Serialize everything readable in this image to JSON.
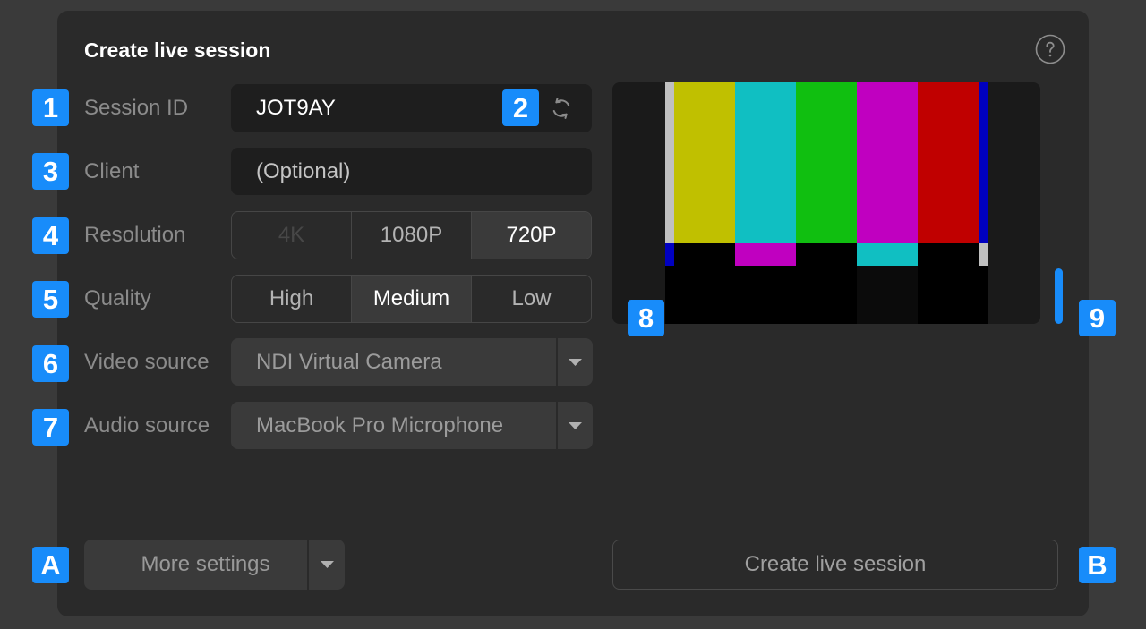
{
  "colors": {
    "page_background": "#3a3a3a",
    "panel_background": "#2a2a2a",
    "field_background": "#1e1e1e",
    "control_background": "#3a3a3a",
    "accent": "#188cfa",
    "label_text": "#8b8b8b",
    "title_text": "#ffffff"
  },
  "dialog": {
    "title": "Create live session",
    "help_icon": "question-circle-icon"
  },
  "form": {
    "session_id": {
      "badge": "1",
      "label": "Session ID",
      "value": "JOT9AY",
      "regenerate_badge": "2",
      "regenerate_icon": "refresh-icon"
    },
    "client": {
      "badge": "3",
      "label": "Client",
      "value": "",
      "placeholder": "(Optional)"
    },
    "resolution": {
      "badge": "4",
      "label": "Resolution",
      "options": [
        {
          "label": "4K",
          "selected": false,
          "disabled": true
        },
        {
          "label": "1080P",
          "selected": false,
          "disabled": false
        },
        {
          "label": "720P",
          "selected": true,
          "disabled": false
        }
      ]
    },
    "quality": {
      "badge": "5",
      "label": "Quality",
      "options": [
        {
          "label": "High",
          "selected": false,
          "disabled": false
        },
        {
          "label": "Medium",
          "selected": true,
          "disabled": false
        },
        {
          "label": "Low",
          "selected": false,
          "disabled": false
        }
      ]
    },
    "video_source": {
      "badge": "6",
      "label": "Video source",
      "value": "NDI Virtual Camera",
      "dropdown_icon": "caret-down-icon"
    },
    "audio_source": {
      "badge": "7",
      "label": "Audio source",
      "value": "MacBook Pro Microphone",
      "dropdown_icon": "caret-down-icon"
    }
  },
  "preview": {
    "badge": "8",
    "color_bars": {
      "top": [
        "#c0c0c0",
        "#c0c000",
        "#10bfc2",
        "#10bf10",
        "#c000c0",
        "#c00000",
        "#0000c0"
      ],
      "middle": [
        "#0000c0",
        "#000000",
        "#c000c0",
        "#000000",
        "#10bfc2",
        "#000000",
        "#c0c0c0"
      ],
      "bottom": [
        "#000000",
        "#000000",
        "#000000",
        "#000000",
        "#0b0b0b",
        "#000000",
        "#000000"
      ]
    }
  },
  "level_meter": {
    "badge": "9",
    "level": 0.23,
    "color": "#188cfa"
  },
  "footer": {
    "more_settings": {
      "badge": "A",
      "label": "More settings",
      "dropdown_icon": "caret-down-icon"
    },
    "create_button": {
      "badge": "B",
      "label": "Create live session"
    }
  }
}
